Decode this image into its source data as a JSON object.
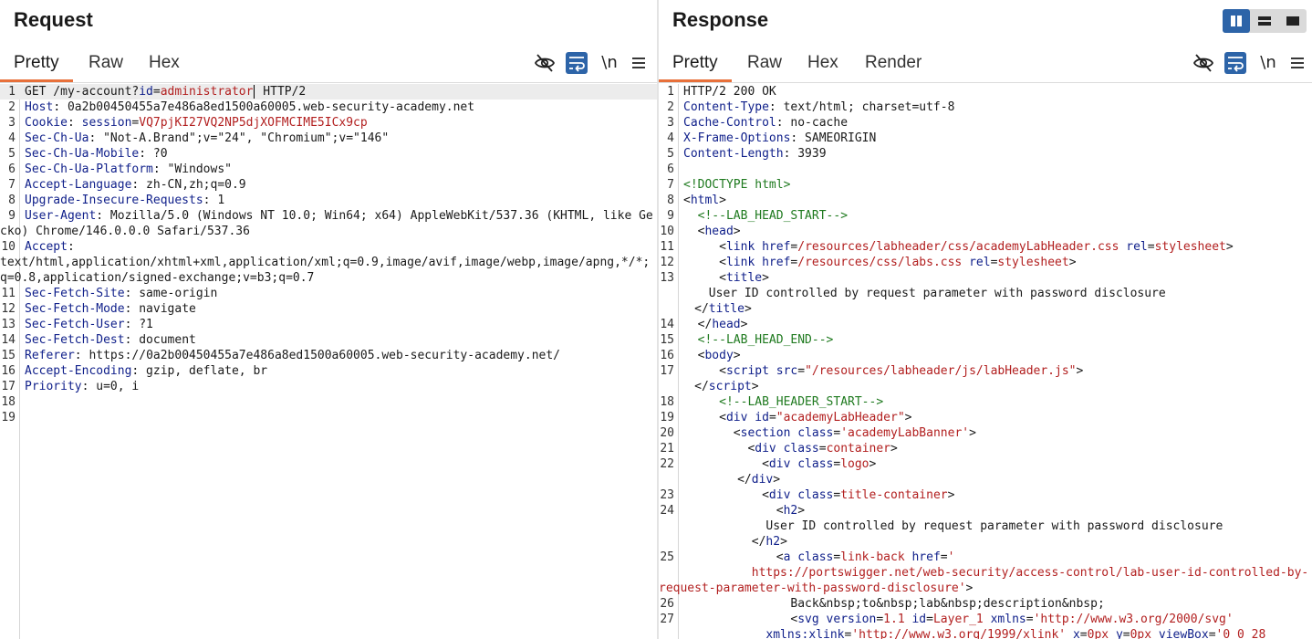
{
  "layout": {
    "buttons": [
      {
        "name": "split-horizontal",
        "active": true
      },
      {
        "name": "split-vertical",
        "active": false
      },
      {
        "name": "single-pane",
        "active": false
      }
    ]
  },
  "request": {
    "title": "Request",
    "tabs": [
      "Pretty",
      "Raw",
      "Hex"
    ],
    "active_tab": "Pretty",
    "toolbar": {
      "newline_label": "\\n"
    },
    "lines": [
      {
        "n": "1",
        "segs": [
          [
            "",
            "GET /my-account?"
          ],
          [
            "pn",
            "id"
          ],
          [
            "",
            "="
          ],
          [
            "pv",
            "administrator"
          ],
          [
            "cursor",
            ""
          ],
          [
            "",
            " HTTP/2"
          ]
        ],
        "current": true
      },
      {
        "n": "2",
        "segs": [
          [
            "hk",
            "Host"
          ],
          [
            "",
            ": 0a2b00450455a7e486a8ed1500a60005.web-security-academy.net"
          ]
        ]
      },
      {
        "n": "3",
        "segs": [
          [
            "hk",
            "Cookie"
          ],
          [
            "",
            ": "
          ],
          [
            "pn",
            "session"
          ],
          [
            "",
            "="
          ],
          [
            "pv",
            "VQ7pjKI27VQ2NP5djXOFMCIME5ICx9cp"
          ]
        ]
      },
      {
        "n": "4",
        "segs": [
          [
            "hk",
            "Sec-Ch-Ua"
          ],
          [
            "",
            ": \"Not-A.Brand\";v=\"24\", \"Chromium\";v=\"146\""
          ]
        ]
      },
      {
        "n": "5",
        "segs": [
          [
            "hk",
            "Sec-Ch-Ua-Mobile"
          ],
          [
            "",
            ": ?0"
          ]
        ]
      },
      {
        "n": "6",
        "segs": [
          [
            "hk",
            "Sec-Ch-Ua-Platform"
          ],
          [
            "",
            ": \"Windows\""
          ]
        ]
      },
      {
        "n": "7",
        "segs": [
          [
            "hk",
            "Accept-Language"
          ],
          [
            "",
            ": zh-CN,zh;q=0.9"
          ]
        ]
      },
      {
        "n": "8",
        "segs": [
          [
            "hk",
            "Upgrade-Insecure-Requests"
          ],
          [
            "",
            ": 1"
          ]
        ]
      },
      {
        "n": "9",
        "segs": [
          [
            "hk",
            "User-Agent"
          ],
          [
            "",
            ": Mozilla/5.0 (Windows NT 10.0; Win64; x64) AppleWebKit/537.36 (KHTML, like Gecko) Chrome/146.0.0.0 Safari/537.36"
          ]
        ]
      },
      {
        "n": "10",
        "segs": [
          [
            "hk",
            "Accept"
          ],
          [
            "",
            ":\ntext/html,application/xhtml+xml,application/xml;q=0.9,image/avif,image/webp,image/apng,*/*;q=0.8,application/signed-exchange;v=b3;q=0.7"
          ]
        ]
      },
      {
        "n": "11",
        "segs": [
          [
            "hk",
            "Sec-Fetch-Site"
          ],
          [
            "",
            ": same-origin"
          ]
        ]
      },
      {
        "n": "12",
        "segs": [
          [
            "hk",
            "Sec-Fetch-Mode"
          ],
          [
            "",
            ": navigate"
          ]
        ]
      },
      {
        "n": "13",
        "segs": [
          [
            "hk",
            "Sec-Fetch-User"
          ],
          [
            "",
            ": ?1"
          ]
        ]
      },
      {
        "n": "14",
        "segs": [
          [
            "hk",
            "Sec-Fetch-Dest"
          ],
          [
            "",
            ": document"
          ]
        ]
      },
      {
        "n": "15",
        "segs": [
          [
            "hk",
            "Referer"
          ],
          [
            "",
            ": https://0a2b00450455a7e486a8ed1500a60005.web-security-academy.net/"
          ]
        ]
      },
      {
        "n": "16",
        "segs": [
          [
            "hk",
            "Accept-Encoding"
          ],
          [
            "",
            ": gzip, deflate, br"
          ]
        ]
      },
      {
        "n": "17",
        "segs": [
          [
            "hk",
            "Priority"
          ],
          [
            "",
            ": u=0, i"
          ]
        ]
      },
      {
        "n": "18",
        "segs": []
      },
      {
        "n": "19",
        "segs": []
      }
    ]
  },
  "response": {
    "title": "Response",
    "tabs": [
      "Pretty",
      "Raw",
      "Hex",
      "Render"
    ],
    "active_tab": "Pretty",
    "toolbar": {
      "newline_label": "\\n"
    },
    "lines": [
      {
        "n": "1",
        "segs": [
          [
            "",
            "HTTP/2 200 OK"
          ]
        ]
      },
      {
        "n": "2",
        "segs": [
          [
            "hk",
            "Content-Type"
          ],
          [
            "",
            ": text/html; charset=utf-8"
          ]
        ]
      },
      {
        "n": "3",
        "segs": [
          [
            "hk",
            "Cache-Control"
          ],
          [
            "",
            ": no-cache"
          ]
        ]
      },
      {
        "n": "4",
        "segs": [
          [
            "hk",
            "X-Frame-Options"
          ],
          [
            "",
            ": SAMEORIGIN"
          ]
        ]
      },
      {
        "n": "5",
        "segs": [
          [
            "hk",
            "Content-Length"
          ],
          [
            "",
            ": 3939"
          ]
        ]
      },
      {
        "n": "6",
        "segs": []
      },
      {
        "n": "7",
        "segs": [
          [
            "cm",
            "<!DOCTYPE html>"
          ]
        ]
      },
      {
        "n": "8",
        "segs": [
          [
            "",
            "<"
          ],
          [
            "tg",
            "html"
          ],
          [
            "",
            ">"
          ]
        ]
      },
      {
        "n": "9",
        "segs": [
          [
            "",
            "  "
          ],
          [
            "cm",
            "<!--LAB_HEAD_START-->"
          ]
        ]
      },
      {
        "n": "10",
        "segs": [
          [
            "",
            "  <"
          ],
          [
            "tg",
            "head"
          ],
          [
            "",
            ">"
          ]
        ]
      },
      {
        "n": "11",
        "segs": [
          [
            "",
            "     <"
          ],
          [
            "tg",
            "link"
          ],
          [
            "",
            " "
          ],
          [
            "at",
            "href"
          ],
          [
            "",
            "="
          ],
          [
            "av",
            "/resources/labheader/css/academyLabHeader.css"
          ],
          [
            "",
            " "
          ],
          [
            "at",
            "rel"
          ],
          [
            "",
            "="
          ],
          [
            "av",
            "stylesheet"
          ],
          [
            "",
            ">"
          ]
        ]
      },
      {
        "n": "12",
        "segs": [
          [
            "",
            "     <"
          ],
          [
            "tg",
            "link"
          ],
          [
            "",
            " "
          ],
          [
            "at",
            "href"
          ],
          [
            "",
            "="
          ],
          [
            "av",
            "/resources/css/labs.css"
          ],
          [
            "",
            " "
          ],
          [
            "at",
            "rel"
          ],
          [
            "",
            "="
          ],
          [
            "av",
            "stylesheet"
          ],
          [
            "",
            ">"
          ]
        ]
      },
      {
        "n": "13",
        "segs": [
          [
            "",
            "     <"
          ],
          [
            "tg",
            "title"
          ],
          [
            "",
            ">\n       User ID controlled by request parameter with password disclosure\n     </"
          ],
          [
            "tg",
            "title"
          ],
          [
            "",
            ">"
          ]
        ]
      },
      {
        "n": "14",
        "segs": [
          [
            "",
            "  </"
          ],
          [
            "tg",
            "head"
          ],
          [
            "",
            ">"
          ]
        ]
      },
      {
        "n": "15",
        "segs": [
          [
            "",
            "  "
          ],
          [
            "cm",
            "<!--LAB_HEAD_END-->"
          ]
        ]
      },
      {
        "n": "16",
        "segs": [
          [
            "",
            "  <"
          ],
          [
            "tg",
            "body"
          ],
          [
            "",
            ">"
          ]
        ]
      },
      {
        "n": "17",
        "segs": [
          [
            "",
            "     <"
          ],
          [
            "tg",
            "script"
          ],
          [
            "",
            " "
          ],
          [
            "at",
            "src"
          ],
          [
            "",
            "="
          ],
          [
            "av",
            "\"/resources/labheader/js/labHeader.js\""
          ],
          [
            "",
            ">\n     </"
          ],
          [
            "tg",
            "script"
          ],
          [
            "",
            ">"
          ]
        ]
      },
      {
        "n": "18",
        "segs": [
          [
            "",
            "     "
          ],
          [
            "cm",
            "<!--LAB_HEADER_START-->"
          ]
        ]
      },
      {
        "n": "19",
        "segs": [
          [
            "",
            "     <"
          ],
          [
            "tg",
            "div"
          ],
          [
            "",
            " "
          ],
          [
            "at",
            "id"
          ],
          [
            "",
            "="
          ],
          [
            "av",
            "\"academyLabHeader\""
          ],
          [
            "",
            ">"
          ]
        ]
      },
      {
        "n": "20",
        "segs": [
          [
            "",
            "       <"
          ],
          [
            "tg",
            "section"
          ],
          [
            "",
            " "
          ],
          [
            "at",
            "class"
          ],
          [
            "",
            "="
          ],
          [
            "av",
            "'academyLabBanner'"
          ],
          [
            "",
            ">"
          ]
        ]
      },
      {
        "n": "21",
        "segs": [
          [
            "",
            "         <"
          ],
          [
            "tg",
            "div"
          ],
          [
            "",
            " "
          ],
          [
            "at",
            "class"
          ],
          [
            "",
            "="
          ],
          [
            "av",
            "container"
          ],
          [
            "",
            ">"
          ]
        ]
      },
      {
        "n": "22",
        "segs": [
          [
            "",
            "           <"
          ],
          [
            "tg",
            "div"
          ],
          [
            "",
            " "
          ],
          [
            "at",
            "class"
          ],
          [
            "",
            "="
          ],
          [
            "av",
            "logo"
          ],
          [
            "",
            ">\n           </"
          ],
          [
            "tg",
            "div"
          ],
          [
            "",
            ">"
          ]
        ]
      },
      {
        "n": "23",
        "segs": [
          [
            "",
            "           <"
          ],
          [
            "tg",
            "div"
          ],
          [
            "",
            " "
          ],
          [
            "at",
            "class"
          ],
          [
            "",
            "="
          ],
          [
            "av",
            "title-container"
          ],
          [
            "",
            ">"
          ]
        ]
      },
      {
        "n": "24",
        "segs": [
          [
            "",
            "             <"
          ],
          [
            "tg",
            "h2"
          ],
          [
            "",
            ">\n               User ID controlled by request parameter with password disclosure\n             </"
          ],
          [
            "tg",
            "h2"
          ],
          [
            "",
            ">"
          ]
        ]
      },
      {
        "n": "25",
        "segs": [
          [
            "",
            "             <"
          ],
          [
            "tg",
            "a"
          ],
          [
            "",
            " "
          ],
          [
            "at",
            "class"
          ],
          [
            "",
            "="
          ],
          [
            "av",
            "link-back"
          ],
          [
            "",
            " "
          ],
          [
            "at",
            "href"
          ],
          [
            "",
            "="
          ],
          [
            "av",
            "'\n             https://portswigger.net/web-security/access-control/lab-user-id-controlled-by-request-parameter-with-password-disclosure'"
          ],
          [
            "",
            ">"
          ]
        ]
      },
      {
        "n": "26",
        "segs": [
          [
            "",
            "               Back&nbsp;to&nbsp;lab&nbsp;description&nbsp;"
          ]
        ]
      },
      {
        "n": "27",
        "segs": [
          [
            "",
            "               <"
          ],
          [
            "tg",
            "svg"
          ],
          [
            "",
            " "
          ],
          [
            "at",
            "version"
          ],
          [
            "",
            "="
          ],
          [
            "av",
            "1.1"
          ],
          [
            "",
            " "
          ],
          [
            "at",
            "id"
          ],
          [
            "",
            "="
          ],
          [
            "av",
            "Layer_1"
          ],
          [
            "",
            " "
          ],
          [
            "at",
            "xmlns"
          ],
          [
            "",
            "="
          ],
          [
            "av",
            "'http://www.w3.org/2000/svg'"
          ],
          [
            "",
            "\n               "
          ],
          [
            "at",
            "xmlns:xlink"
          ],
          [
            "",
            "="
          ],
          [
            "av",
            "'http://www.w3.org/1999/xlink'"
          ],
          [
            "",
            " "
          ],
          [
            "at",
            "x"
          ],
          [
            "",
            "="
          ],
          [
            "av",
            "0px"
          ],
          [
            "",
            " "
          ],
          [
            "at",
            "y"
          ],
          [
            "",
            "="
          ],
          [
            "av",
            "0px"
          ],
          [
            "",
            " "
          ],
          [
            "at",
            "viewBox"
          ],
          [
            "",
            "="
          ],
          [
            "av",
            "'0 0 28"
          ]
        ]
      }
    ]
  }
}
